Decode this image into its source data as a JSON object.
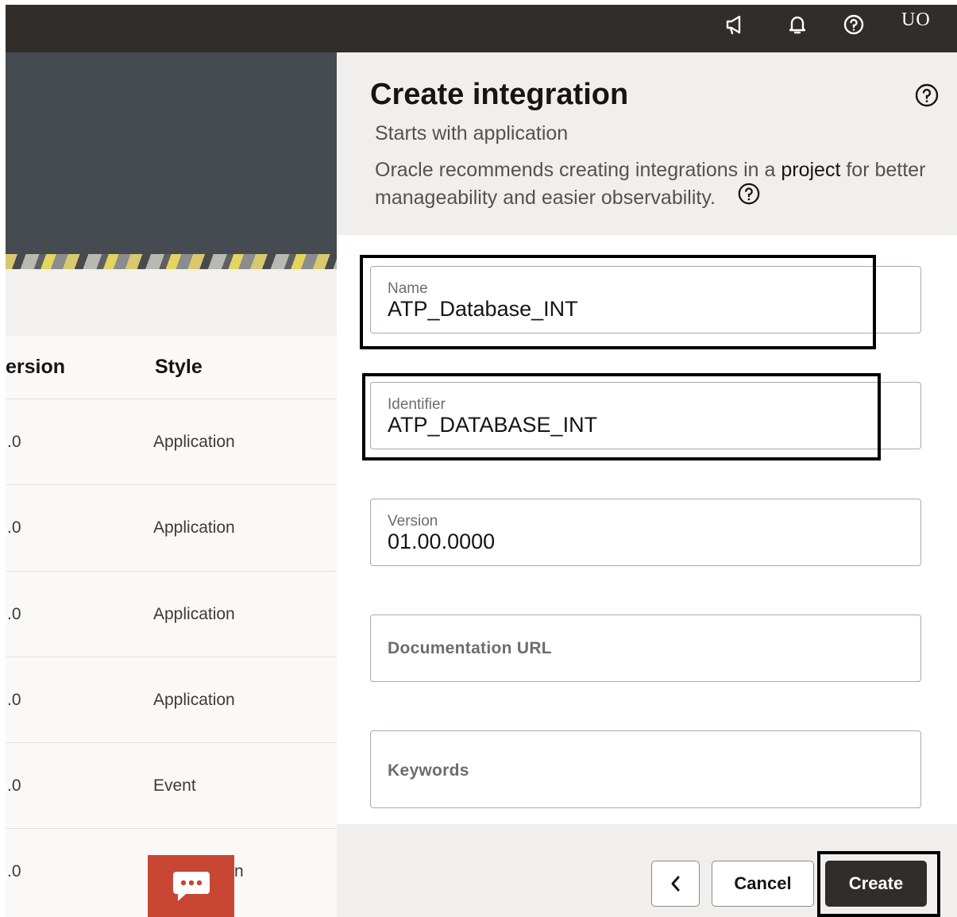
{
  "topbar": {
    "icons": [
      "megaphone-icon",
      "bell-icon",
      "help-icon"
    ],
    "user_initials": "UO"
  },
  "table": {
    "headers": {
      "version": "ersion",
      "style": "Style"
    },
    "rows": [
      {
        "version": ".0",
        "style": "Application"
      },
      {
        "version": ".0",
        "style": "Application"
      },
      {
        "version": ".0",
        "style": "Application"
      },
      {
        "version": ".0",
        "style": "Application"
      },
      {
        "version": ".0",
        "style": "Event"
      },
      {
        "version": ".0",
        "style": "n"
      }
    ]
  },
  "chat": {
    "icon": "chat-bubble-icon",
    "color": "#c74634"
  },
  "panel": {
    "title": "Create integration",
    "subtitle": "Starts with application",
    "description": {
      "before": "Oracle recommends creating integrations in a ",
      "emphasis": "project",
      "after": " for better manageability and easier observability."
    },
    "fields": {
      "name": {
        "label": "Name",
        "value": "ATP_Database_INT"
      },
      "identifier": {
        "label": "Identifier",
        "value": "ATP_DATABASE_INT"
      },
      "version": {
        "label": "Version",
        "value": "01.00.0000"
      },
      "documentation_url": {
        "placeholder": "Documentation URL"
      },
      "keywords": {
        "placeholder": "Keywords"
      }
    },
    "footer": {
      "back_icon": "chevron-left-icon",
      "cancel_label": "Cancel",
      "create_label": "Create"
    }
  },
  "colors": {
    "topbar": "#312d2a",
    "hero": "#464b52",
    "panel_header": "#f1efed",
    "primary_button": "#312d2a",
    "highlight_box": "#000000"
  }
}
